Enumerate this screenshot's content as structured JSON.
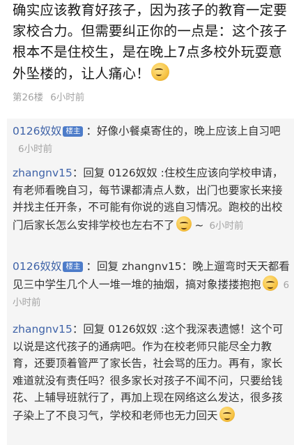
{
  "main_post": {
    "text": "确实应该教育好孩子，因为孩子的教育一定要家校合力。但需要纠正你的一点是：这个孩子根本不是住校生，是在晚上7点多校外玩耍意外坠楼的，让人痛心！",
    "floor": "第26楼",
    "time": "6小时前"
  },
  "replies": [
    {
      "user": "0126奴奴",
      "badge": "楼主",
      "text": "：好像小餐桌寄住的，晚上应该上自习吧",
      "time": "6小时前"
    },
    {
      "user": "zhangnv15",
      "text": "：回复 0126奴奴 :住校生应该向学校申请，有老师看晚自习，每节课都清点人数，出门也要家长来接并找主任开条，不可能有你说的逃自习情况。跑校的出校门后家长怎么安排学校也左右不了",
      "tail": "~",
      "time": "6小时前"
    },
    {
      "user": "0126奴奴",
      "badge": "楼主",
      "text": "：回复 zhangnv15：晚上遛弯时天天都看见三中学生几个人一堆一堆的抽烟，搞对象搂搂抱抱",
      "time": "6小时前"
    },
    {
      "user": "zhangnv15",
      "text": "：回复 0126奴奴 :这个我深表遗憾！这个可以说是这代孩子的通病吧。作为在校老师只能尽全力教育，还要顶着管严了家长告，社会骂的压力。再有，家长难道就没有责任吗？很多家长对孩子不闻不问，只要给钱花、上辅导班就行了，再加上现在网络这么发达，很多孩子染上了不良习气，学校和老师也无力回天",
      "watermark": "",
      "time": ""
    }
  ]
}
